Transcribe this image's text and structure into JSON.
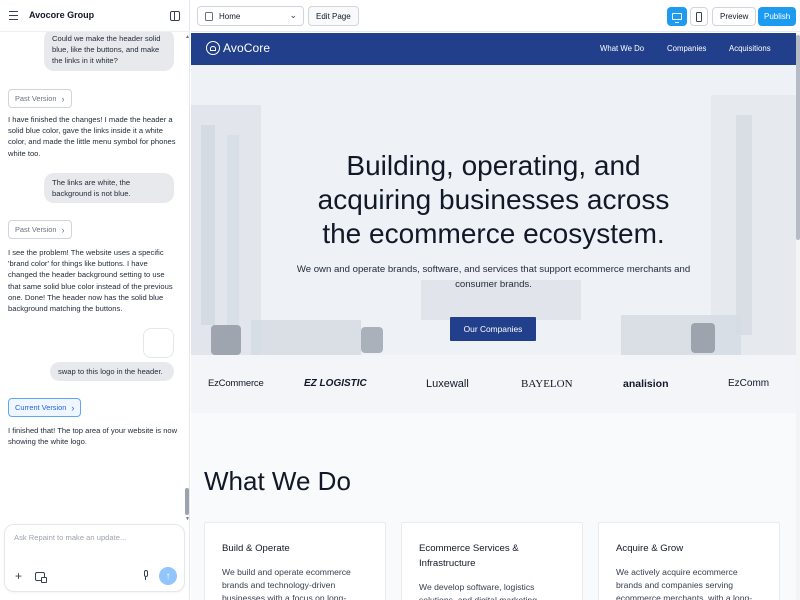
{
  "app": {
    "group_name": "Avocore Group"
  },
  "chat": {
    "messages": [
      {
        "role": "user",
        "text": "Could we make the header solid blue, like the buttons, and make the links in it white?"
      },
      {
        "role": "assistant",
        "text": "I have finished the changes! I made the header a solid blue color, gave the links inside it a white color, and made the little menu symbol for phones white too."
      },
      {
        "role": "user",
        "text": "The links are white, the background is not blue."
      },
      {
        "role": "assistant",
        "text": "I see the problem! The website uses a specific 'brand color' for things like buttons. I have changed the header background setting to use that same solid blue color instead of the previous one. Done! The header now has the solid blue background matching the buttons."
      },
      {
        "role": "user",
        "text": "swap to this logo in the header."
      },
      {
        "role": "assistant",
        "text": "I finished that! The top area of your website is now showing the white logo."
      }
    ],
    "versions": {
      "past_1": "Past Version",
      "past_2": "Past Version",
      "current": "Current Version"
    },
    "composer_placeholder": "Ask Repaint to make an update..."
  },
  "toolbar": {
    "page_select_value": "Home",
    "edit_page_label": "Edit Page",
    "preview_label": "Preview",
    "publish_label": "Publish",
    "active_device": "desktop"
  },
  "site": {
    "logo_text": "AvoCore",
    "nav_links": [
      "What We Do",
      "Companies",
      "Acquisitions"
    ],
    "hero_title_lines": [
      "Building, operating, and",
      "acquiring businesses across",
      "the ecommerce ecosystem."
    ],
    "hero_subtitle": "We own and operate brands, software, and services that support ecommerce merchants and consumer brands.",
    "hero_cta": "Our Companies",
    "brands": [
      "EzCommerce",
      "EZ LOGISTIC",
      "Luxewall",
      "BAYELON",
      "analision",
      "EzComm"
    ],
    "section_title": "What We Do",
    "cards": [
      {
        "title": "Build & Operate",
        "text": "We build and operate ecommerce brands and technology-driven businesses with a focus on long-"
      },
      {
        "title": "Ecommerce Services & Infrastructure",
        "text": "We develop software, logistics solutions, and digital marketing"
      },
      {
        "title": "Acquire & Grow",
        "text": "We actively acquire ecommerce brands and companies serving ecommerce merchants, with a long-"
      }
    ]
  },
  "colors": {
    "site_brand_blue": "#213f8a",
    "toolbar_accent": "#1d9bf0"
  }
}
